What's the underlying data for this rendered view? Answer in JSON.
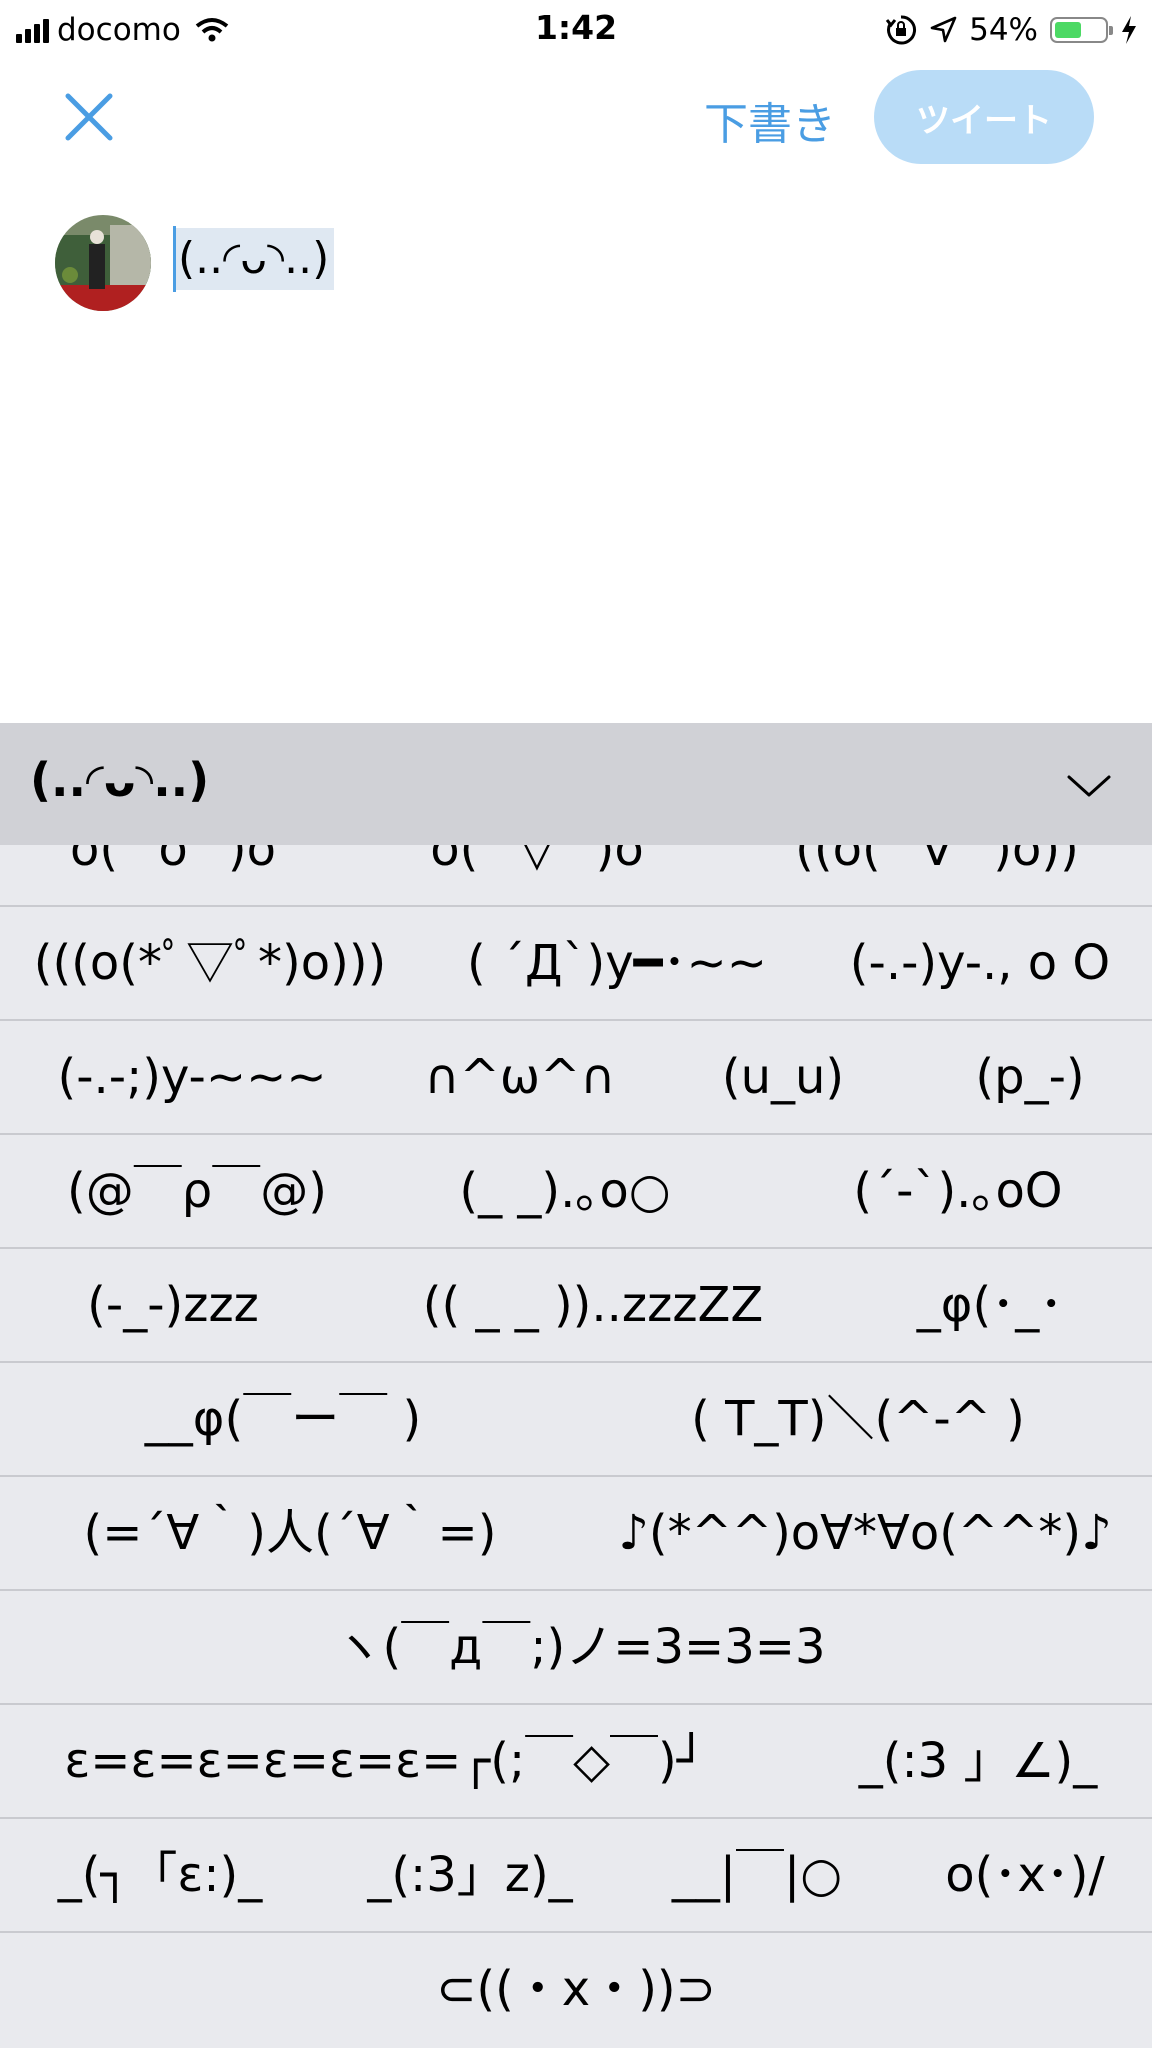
{
  "status_bar": {
    "carrier": "docomo",
    "time": "1:42",
    "battery": "54%",
    "battery_level": 0.54
  },
  "nav": {
    "drafts": "下書き",
    "tweet": "ツイート"
  },
  "compose": {
    "text": "(..◜ᴗ◝..)"
  },
  "keyboard": {
    "candidate": "(..◜ᴗ◝..)",
    "rows": [
      [
        "o(^o^)o",
        "o(^▽^)o",
        "((o(^∇^)o))"
      ],
      [
        "(((o(*ﾟ▽ﾟ*)o)))",
        "( ´Д`)y━･~~",
        "(-.-)y-., o O"
      ],
      [
        "(-.-;)y-~~~",
        "∩^ω^∩",
        "(u_u)",
        "(p_-)"
      ],
      [
        "(@￣ρ￣@)",
        "(_ _).｡o○",
        "(´-`).｡oO"
      ],
      [
        "(-_-)zzz",
        "(( _ _ ))..zzzZZ",
        "_φ(･_･"
      ],
      [
        "__φ(￣ー￣ )",
        "( T_T)＼(^-^ )"
      ],
      [
        "(=´∀｀)人(´∀｀=)",
        "♪(*^^)o∀*∀o(^^*)♪"
      ],
      [
        "ヽ(￣д￣;)ノ=3=3=3"
      ],
      [
        "ε=ε=ε=ε=ε=ε=┌(;￣◇￣)┘",
        "_(:3 」∠)_"
      ],
      [
        "_(┐「ε:)_",
        "_(:3」z)_",
        "__|￣|○",
        "o(･x･)/"
      ],
      [
        "⊂((・x・))⊃"
      ]
    ]
  }
}
